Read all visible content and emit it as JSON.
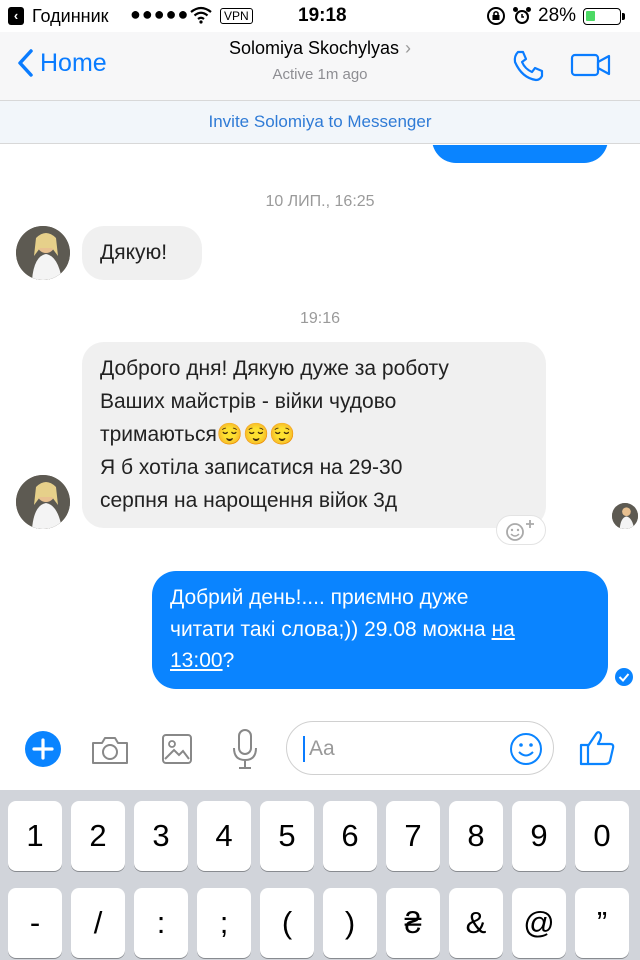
{
  "status": {
    "back_glyph": "‹",
    "carrier": "Годинник",
    "signal": "●●●●●",
    "vpn": "VPN",
    "time": "19:18",
    "battery_pct": "28%",
    "battery_level": 0.28
  },
  "nav": {
    "back_label": "Home",
    "contact_name": "Solomiya Skochylyas",
    "chevron": "›",
    "status": "Active 1m ago"
  },
  "invite": {
    "label": "Invite Solomiya to Messenger"
  },
  "messages": {
    "stamp1": "10 ЛИП., 16:25",
    "msg1": "Дякую!",
    "stamp2": "19:16",
    "msg2_l1": "Доброго дня! Дякую дуже за роботу",
    "msg2_l2": "Ваших майстрів - війки чудово",
    "msg2_l3": "тримаються😌😌😌",
    "msg2_l4": "Я б хотіла записатися на 29-30",
    "msg2_l5": "серпня на нарощення війок 3д",
    "msg3_l1": "Добрий день!.... приємно дуже",
    "msg3_l2a": "читати такі слова;)) 29.08 можна ",
    "msg3_l2b": "на",
    "msg3_l3a": "13:00",
    "msg3_l3b": "?"
  },
  "composer": {
    "placeholder": "Aa"
  },
  "keyboard": {
    "row1": [
      "1",
      "2",
      "3",
      "4",
      "5",
      "6",
      "7",
      "8",
      "9",
      "0"
    ],
    "row2": [
      "-",
      "/",
      ":",
      ";",
      "(",
      ")",
      "₴",
      "&",
      "@",
      "”"
    ]
  },
  "colors": {
    "accent": "#0a84ff",
    "bubble_in": "#f0f0f0"
  }
}
